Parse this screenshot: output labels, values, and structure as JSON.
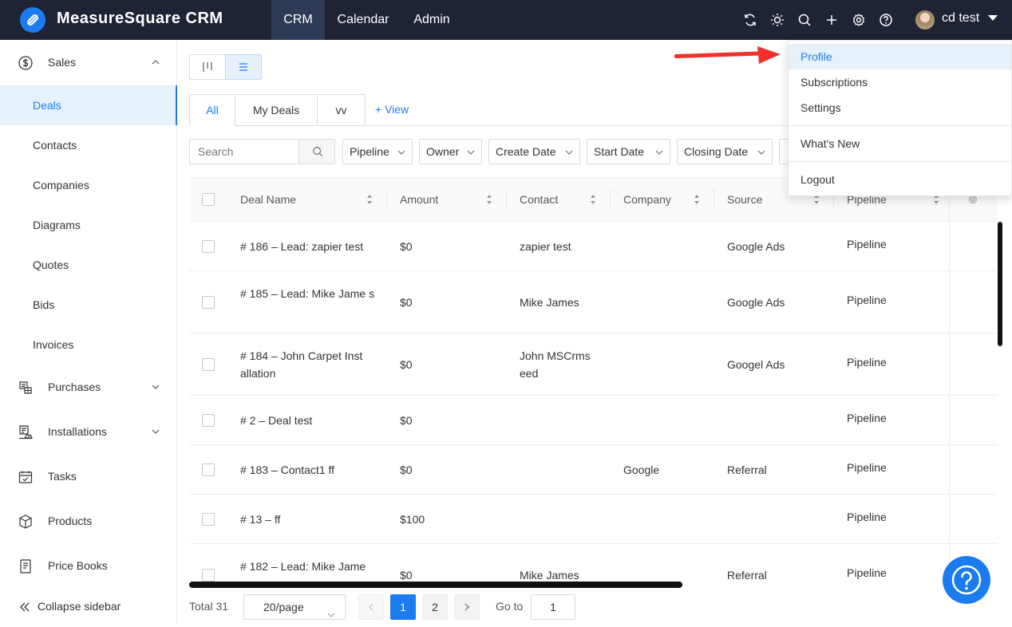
{
  "app": {
    "brand": "MeasureSquare CRM"
  },
  "nav": [
    {
      "label": "CRM"
    },
    {
      "label": "Calendar"
    },
    {
      "label": "Admin"
    }
  ],
  "user": {
    "name": "cd test"
  },
  "sidebar": {
    "sales": "Sales",
    "sales_items": [
      {
        "label": "Deals"
      },
      {
        "label": "Contacts"
      },
      {
        "label": "Companies"
      },
      {
        "label": "Diagrams"
      },
      {
        "label": "Quotes"
      },
      {
        "label": "Bids"
      },
      {
        "label": "Invoices"
      }
    ],
    "purchases": "Purchases",
    "installations": "Installations",
    "tasks": "Tasks",
    "products": "Products",
    "price_books": "Price Books",
    "collapse": "Collapse sidebar"
  },
  "views": {
    "tabs": [
      {
        "label": "All"
      },
      {
        "label": "My Deals"
      },
      {
        "label": "vv"
      }
    ],
    "add_view": "+ View"
  },
  "filters": {
    "search_placeholder": "Search",
    "items": [
      {
        "label": "Pipeline"
      },
      {
        "label": "Owner"
      },
      {
        "label": "Create Date"
      },
      {
        "label": "Start Date"
      },
      {
        "label": "Closing Date"
      }
    ]
  },
  "table": {
    "headers": {
      "deal_name": "Deal Name",
      "amount": "Amount",
      "contact": "Contact",
      "company": "Company",
      "source": "Source",
      "pipeline": "Pipeline"
    },
    "rows": [
      {
        "name": "# 186 – Lead: zapier test",
        "amount": "$0",
        "contact": "zapier test",
        "company": "",
        "source": "Google Ads",
        "pipeline": "Pipeline"
      },
      {
        "name": "# 185 – Lead: Mike Jame s",
        "amount": "$0",
        "contact": "Mike James",
        "company": "",
        "source": "Google Ads",
        "pipeline": "Pipeline"
      },
      {
        "name": "# 184 – John Carpet Inst allation",
        "amount": "$0",
        "contact": "John MSCrms eed",
        "company": "",
        "source": "Googel Ads",
        "pipeline": "Pipeline"
      },
      {
        "name": "# 2 – Deal test",
        "amount": "$0",
        "contact": "",
        "company": "",
        "source": "",
        "pipeline": "Pipeline"
      },
      {
        "name": "# 183 – Contact1 ff",
        "amount": "$0",
        "contact": "",
        "company": "Google",
        "source": "Referral",
        "pipeline": "Pipeline"
      },
      {
        "name": "# 13 – ff",
        "amount": "$100",
        "contact": "",
        "company": "",
        "source": "",
        "pipeline": "Pipeline"
      },
      {
        "name": "# 182 – Lead: Mike Jame",
        "amount": "$0",
        "contact": "Mike James",
        "company": "",
        "source": "Referral",
        "pipeline": "Pipeline"
      }
    ]
  },
  "pagination": {
    "total": "Total 31",
    "page_size": "20/page",
    "page1": "1",
    "page2": "2",
    "goto_label": "Go to",
    "goto_value": "1"
  },
  "user_menu": {
    "items": [
      {
        "label": "Profile"
      },
      {
        "label": "Subscriptions"
      },
      {
        "label": "Settings"
      },
      {
        "label": "What's New"
      },
      {
        "label": "Logout"
      }
    ]
  },
  "colors": {
    "topbar": "#1f2435",
    "accent": "#1b7cf0",
    "annotation_arrow": "#f0302a"
  }
}
